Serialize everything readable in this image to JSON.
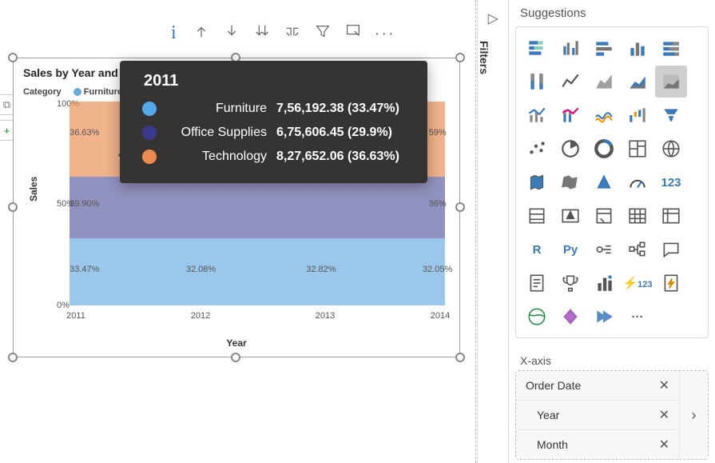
{
  "toolbar": {
    "info": "i",
    "tools": [
      "pin-up",
      "pin-down",
      "sort",
      "drill",
      "filter",
      "expand",
      "more"
    ]
  },
  "left_tools": {
    "link": "⧉",
    "plus": "+"
  },
  "filters_rail": {
    "label": "Filters"
  },
  "chart_data": {
    "type": "area",
    "stacked_100": true,
    "title": "Sales by Year and Category",
    "xlabel": "Year",
    "ylabel": "Sales",
    "categories": [
      "2011",
      "2012",
      "2013",
      "2014"
    ],
    "ylim": [
      0,
      100
    ],
    "yticks": [
      "0%",
      "50%",
      "100%"
    ],
    "legend": {
      "title": "Category",
      "position": "top",
      "items": [
        "Furniture",
        "Office Supplies",
        "Technology"
      ]
    },
    "series": [
      {
        "name": "Furniture",
        "color": "#66acdf",
        "values_pct": [
          33.47,
          32.08,
          32.82,
          32.05
        ]
      },
      {
        "name": "Office Supplies",
        "color": "#3a3a8e",
        "values_pct": [
          29.9,
          30.1,
          30.36,
          30.36
        ]
      },
      {
        "name": "Technology",
        "color": "#eb8c4e",
        "values_pct": [
          36.63,
          37.82,
          36.82,
          37.59
        ]
      }
    ],
    "data_labels": {
      "2011": {
        "Furniture": "33.47%",
        "Office Supplies": "29.90%",
        "Technology": "36.63%"
      },
      "2012": {
        "Furniture": "32.08%"
      },
      "2013": {
        "Furniture": "32.82%"
      },
      "2014": {
        "Furniture": "32.05%",
        "Office Supplies": "36%",
        "Technology": "59%"
      }
    },
    "tooltip": {
      "year": "2011",
      "rows": [
        {
          "name": "Furniture",
          "color": "#52a8e8",
          "value": "7,56,192.38 (33.47%)"
        },
        {
          "name": "Office Supplies",
          "color": "#3a3a8e",
          "value": "6,75,606.45 (29.9%)"
        },
        {
          "name": "Technology",
          "color": "#eb8c4e",
          "value": "8,27,652.06 (36.63%)"
        }
      ]
    }
  },
  "suggestions": {
    "header": "Suggestions",
    "visuals": [
      "stacked-bar",
      "clustered-column",
      "stacked-bar-h",
      "clustered-bar",
      "100-stacked-bar",
      "100-stacked-column",
      "line",
      "area",
      "stacked-area",
      "100-stacked-area",
      "line-column",
      "line-stacked",
      "wave",
      "waterfall",
      "funnel",
      "scatter",
      "pie",
      "donut",
      "treemap",
      "map-globe",
      "filled-map",
      "shape-map",
      "azure-map",
      "gauge",
      "card-123",
      "multi-row-card",
      "kpi",
      "slicer",
      "table",
      "matrix",
      "r",
      "py",
      "key-influencers",
      "decomposition-tree",
      "qna",
      "paginated",
      "trophy",
      "bar-goal",
      "lightning-123",
      "lightning-report",
      "arcgis",
      "power-apps",
      "power-automate",
      "more"
    ],
    "selected_index": 9
  },
  "xaxis_well": {
    "header": "X-axis",
    "parent": "Order Date",
    "children": [
      "Year",
      "Month"
    ]
  }
}
